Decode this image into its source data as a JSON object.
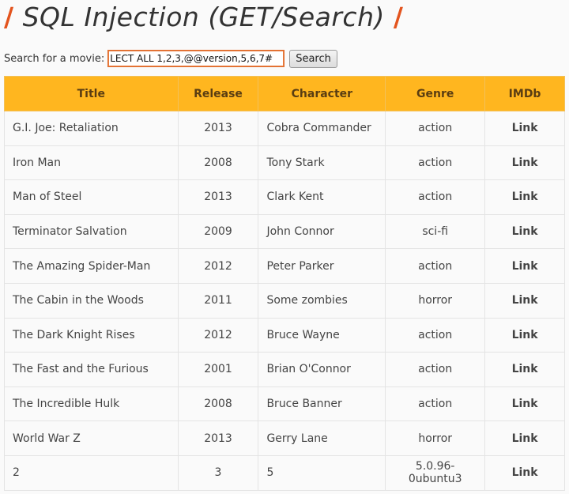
{
  "header": {
    "slash_left": "/",
    "title": "SQL Injection (GET/Search)",
    "slash_right": "/"
  },
  "search": {
    "label": "Search for a movie:",
    "value": "LECT ALL 1,2,3,@@version,5,6,7#",
    "button_label": "Search"
  },
  "table": {
    "columns": [
      "Title",
      "Release",
      "Character",
      "Genre",
      "IMDb"
    ],
    "rows": [
      {
        "title": "G.I. Joe: Retaliation",
        "release": "2013",
        "character": "Cobra Commander",
        "genre": "action",
        "imdb": "Link"
      },
      {
        "title": "Iron Man",
        "release": "2008",
        "character": "Tony Stark",
        "genre": "action",
        "imdb": "Link"
      },
      {
        "title": "Man of Steel",
        "release": "2013",
        "character": "Clark Kent",
        "genre": "action",
        "imdb": "Link"
      },
      {
        "title": "Terminator Salvation",
        "release": "2009",
        "character": "John Connor",
        "genre": "sci-fi",
        "imdb": "Link"
      },
      {
        "title": "The Amazing Spider-Man",
        "release": "2012",
        "character": "Peter Parker",
        "genre": "action",
        "imdb": "Link"
      },
      {
        "title": "The Cabin in the Woods",
        "release": "2011",
        "character": "Some zombies",
        "genre": "horror",
        "imdb": "Link"
      },
      {
        "title": "The Dark Knight Rises",
        "release": "2012",
        "character": "Bruce Wayne",
        "genre": "action",
        "imdb": "Link"
      },
      {
        "title": "The Fast and the Furious",
        "release": "2001",
        "character": "Brian O'Connor",
        "genre": "action",
        "imdb": "Link"
      },
      {
        "title": "The Incredible Hulk",
        "release": "2008",
        "character": "Bruce Banner",
        "genre": "action",
        "imdb": "Link"
      },
      {
        "title": "World War Z",
        "release": "2013",
        "character": "Gerry Lane",
        "genre": "horror",
        "imdb": "Link"
      },
      {
        "title": "2",
        "release": "3",
        "character": "5",
        "genre": "5.0.96-0ubuntu3",
        "imdb": "Link"
      }
    ]
  },
  "colors": {
    "accent": "#e3541e",
    "header_bg": "#ffb61f",
    "header_text": "#5a3d12"
  }
}
